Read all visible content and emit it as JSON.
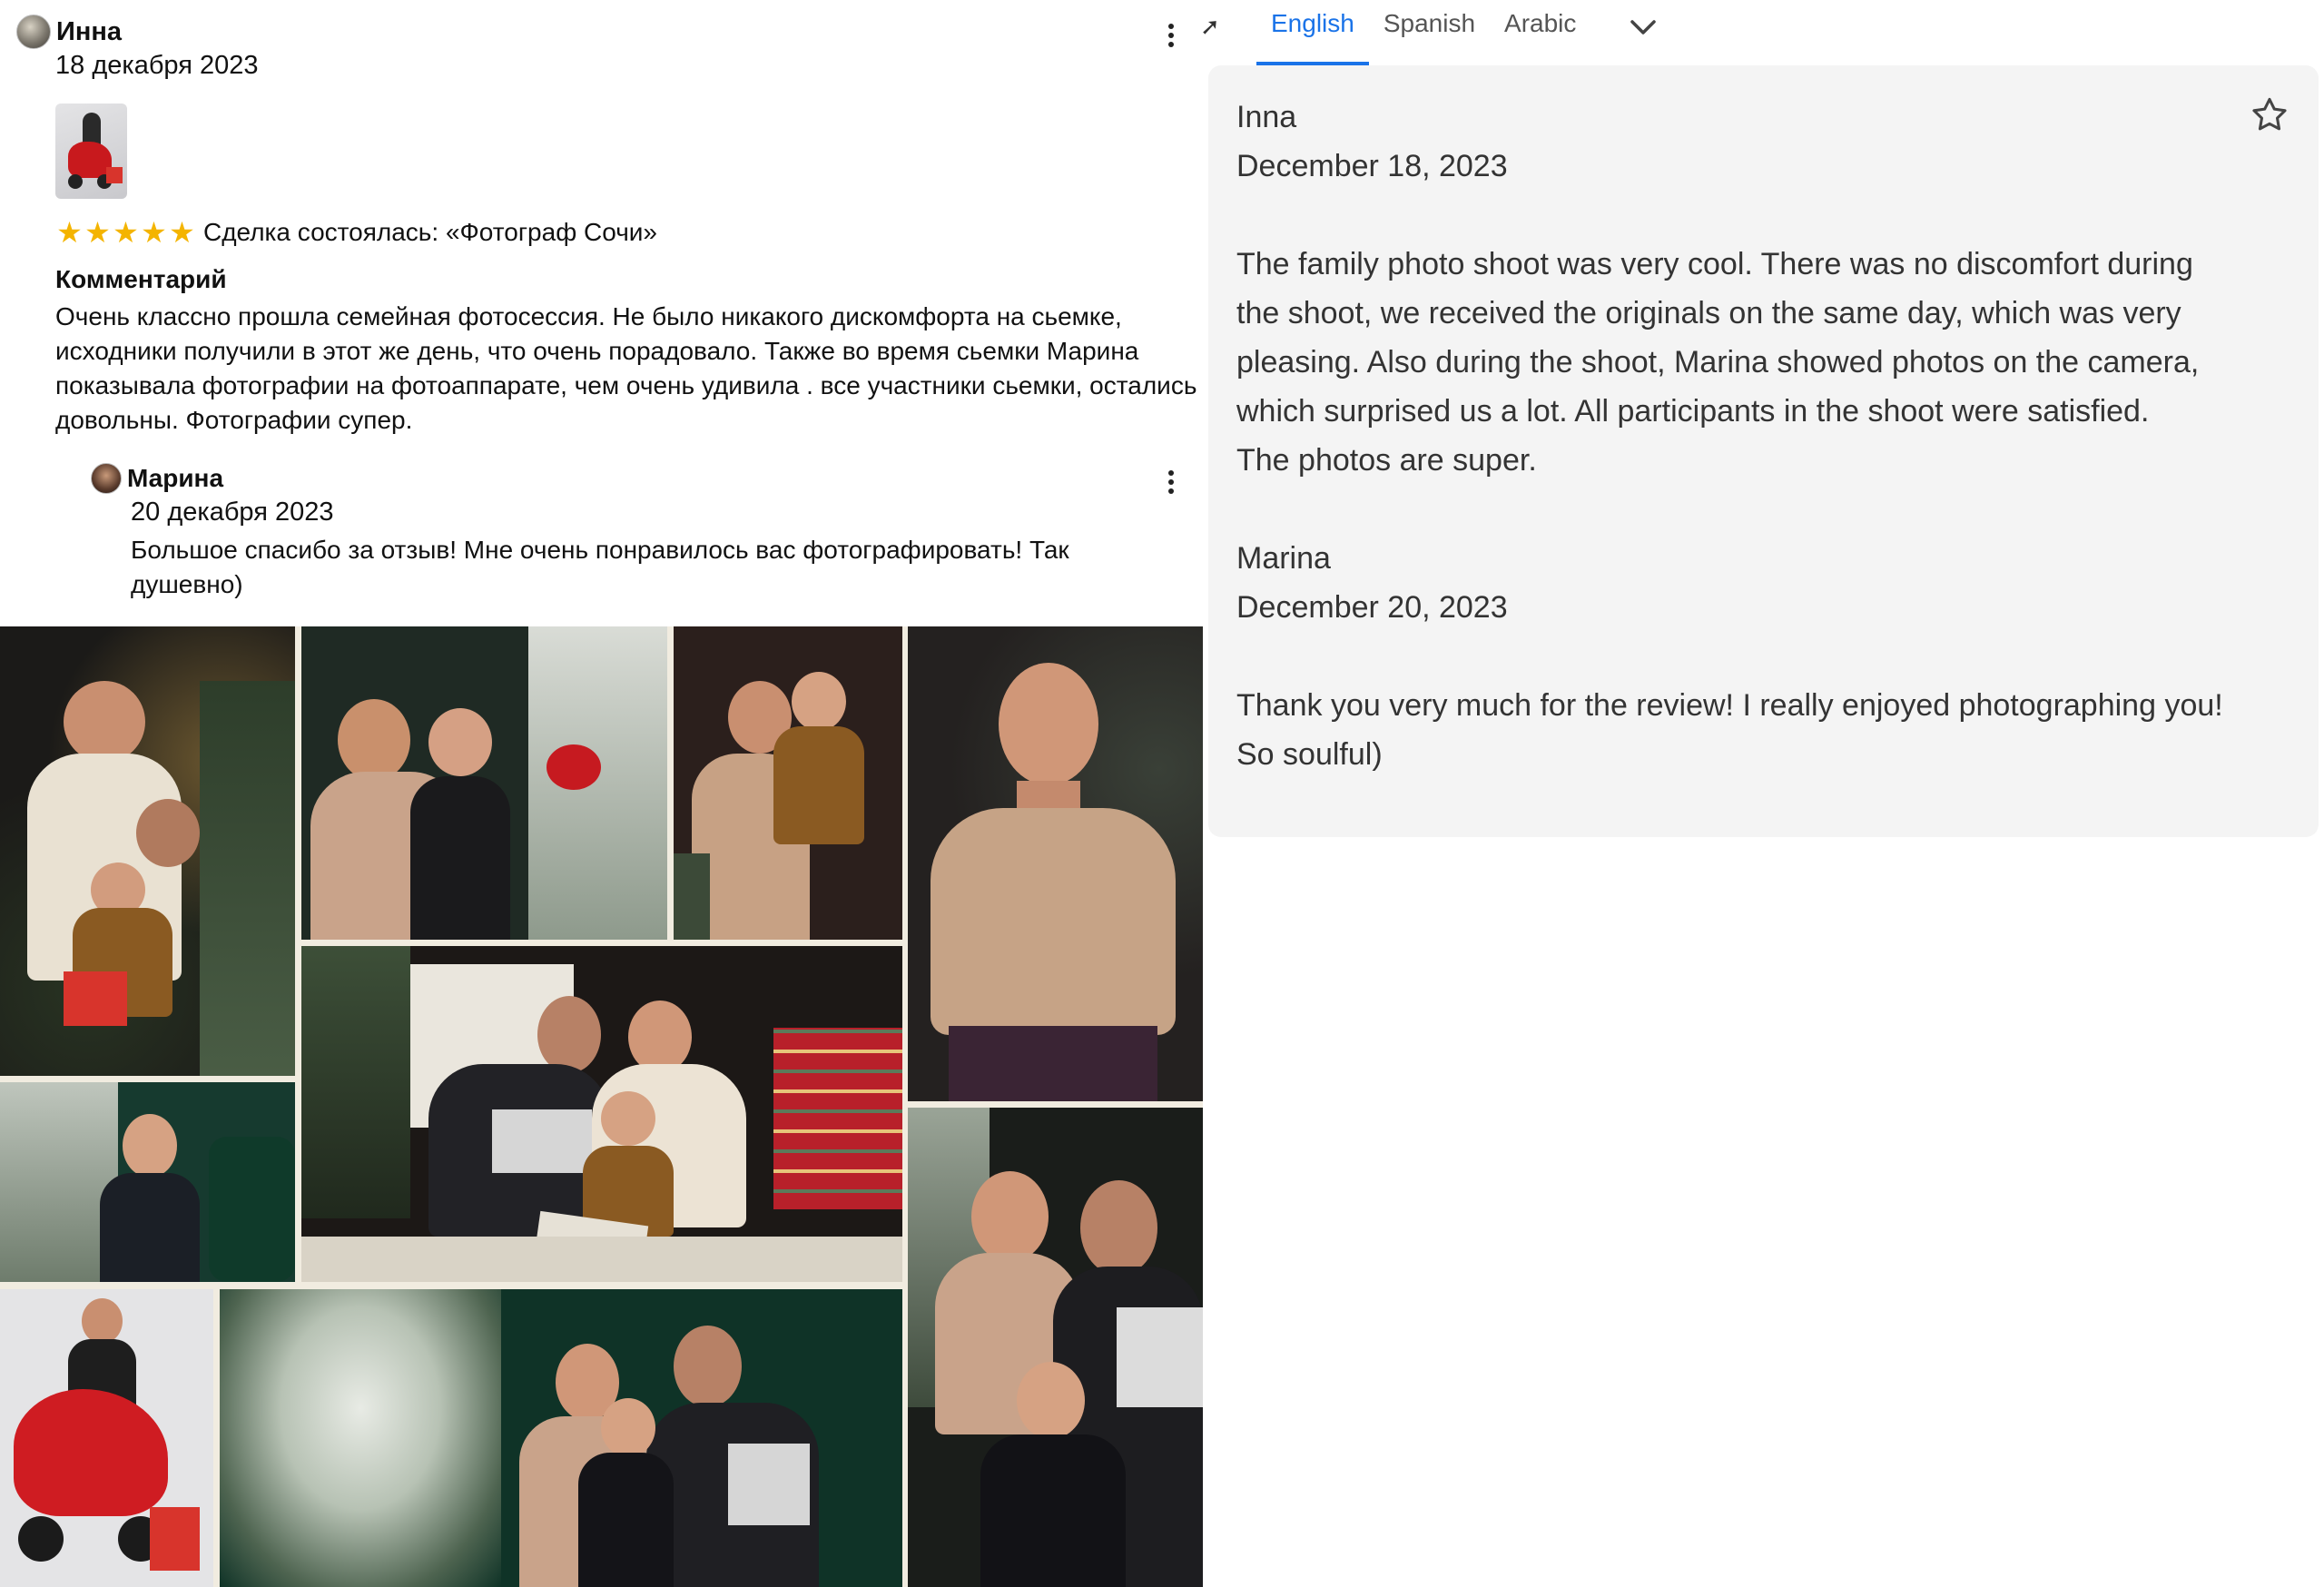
{
  "review": {
    "author": "Инна",
    "date": "18 декабря 2023",
    "rating": 5,
    "deal_label": "Сделка состоялась: «Фотограф Сочи»",
    "comment_title": "Комментарий",
    "comment_text": "Очень классно прошла семейная фотосессия. Не было никакого дискомфорта на сьемке, исходники получили в этот же день, что очень порадовало. Также во время сьемки Марина показывала фотографии на фотоаппарате, чем очень удивила . все участники сьемки, остались довольны. Фотографии супер.",
    "reply": {
      "author": "Марина",
      "date": "20 декабря 2023",
      "text": "Большое спасибо за отзыв! Мне очень понравилось вас фотографировать! Так душевно)"
    }
  },
  "translation": {
    "tabs": [
      "English",
      "Spanish",
      "Arabic"
    ],
    "active_tab": "English",
    "text": "Inna\nDecember 18, 2023\n\nThe family photo shoot was very cool. There was no discomfort during\nthe shoot, we received the originals on the same day, which was very\npleasing. Also during the shoot, Marina showed photos on the camera,\nwhich surprised us a lot. All participants in the shoot were satisfied.\nThe photos are super.\n\nMarina\nDecember 20, 2023\n\nThank you very much for the review! I really enjoyed photographing you!\nSo soulful)"
  },
  "icons": {
    "translate": "translate-icon",
    "more": "more-vert-icon",
    "chevron": "chevron-down-icon",
    "favorite": "star-outline-icon"
  },
  "colors": {
    "accent_blue": "#1a73e8",
    "star_gold": "#f4b400",
    "panel_bg": "#f4f4f4"
  }
}
